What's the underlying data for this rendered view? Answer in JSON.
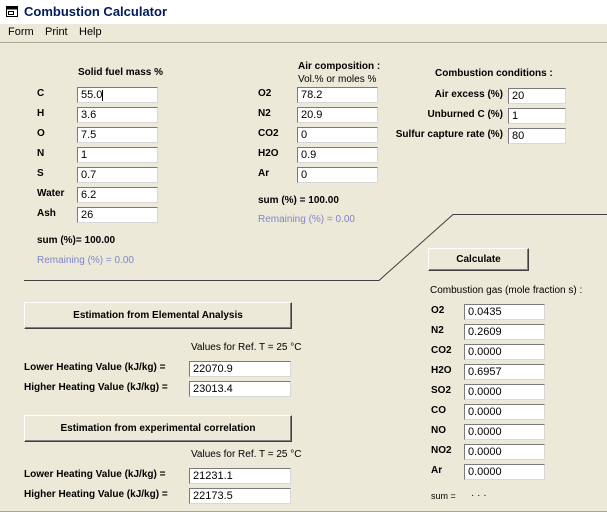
{
  "window": {
    "title": "Combustion Calculator"
  },
  "menu": {
    "items": [
      "Form",
      "Print",
      "Help"
    ]
  },
  "solid_fuel": {
    "heading": "Solid fuel mass %",
    "rows": [
      {
        "label": "C",
        "value": "55.0"
      },
      {
        "label": "H",
        "value": "3.6"
      },
      {
        "label": "O",
        "value": "7.5"
      },
      {
        "label": "N",
        "value": "1"
      },
      {
        "label": "S",
        "value": "0.7"
      },
      {
        "label": "Water",
        "value": "6.2"
      },
      {
        "label": "Ash",
        "value": "26"
      }
    ],
    "sum_text": "sum (%)= 100.00",
    "remaining_text": "Remaining (%) = 0.00"
  },
  "air": {
    "heading": "Air composition :",
    "subheading": "Vol.% or  moles %",
    "rows": [
      {
        "label": "O2",
        "value": "78.2"
      },
      {
        "label": "N2",
        "value": "20.9"
      },
      {
        "label": "CO2",
        "value": "0"
      },
      {
        "label": "H2O",
        "value": "0.9"
      },
      {
        "label": "Ar",
        "value": "0"
      }
    ],
    "sum_text": "sum (%) =   100.00",
    "remaining_text": "Remaining (%) = 0.00"
  },
  "conditions": {
    "heading": "Combustion conditions :",
    "rows": [
      {
        "label": "Air excess (%)",
        "value": "20"
      },
      {
        "label": "Unburned C (%)",
        "value": "1"
      },
      {
        "label": "Sulfur capture rate (%)",
        "value": "80"
      }
    ]
  },
  "calculate_label": "Calculate",
  "gas": {
    "heading": "Combustion gas (mole fraction s) :",
    "rows": [
      {
        "label": "O2",
        "value": "0.0435"
      },
      {
        "label": "N2",
        "value": "0.2609"
      },
      {
        "label": "CO2",
        "value": "0.0000"
      },
      {
        "label": "H2O",
        "value": "0.6957"
      },
      {
        "label": "SO2",
        "value": "0.0000"
      },
      {
        "label": "CO",
        "value": "0.0000"
      },
      {
        "label": "NO",
        "value": "0.0000"
      },
      {
        "label": "NO2",
        "value": "0.0000"
      },
      {
        "label": "Ar",
        "value": "0.0000"
      }
    ],
    "sum_text": "sum =",
    "sum_value": "· · ·"
  },
  "elemental": {
    "button_label": "Estimation from Elemental Analysis",
    "ref_text": "Values for Ref. T = 25 °C",
    "lhv_label": "Lower Heating Value (kJ/kg) =",
    "lhv_value": "22070.9",
    "hhv_label": "Higher Heating Value (kJ/kg) =",
    "hhv_value": "23013.4"
  },
  "experimental": {
    "button_label": "Estimation from experimental correlation",
    "ref_text": "Values for Ref. T = 25 °C",
    "lhv_label": "Lower Heating Value (kJ/kg) =",
    "lhv_value": "21231.1",
    "hhv_label": "Higher Heating Value (kJ/kg) =",
    "hhv_value": "22173.5"
  }
}
